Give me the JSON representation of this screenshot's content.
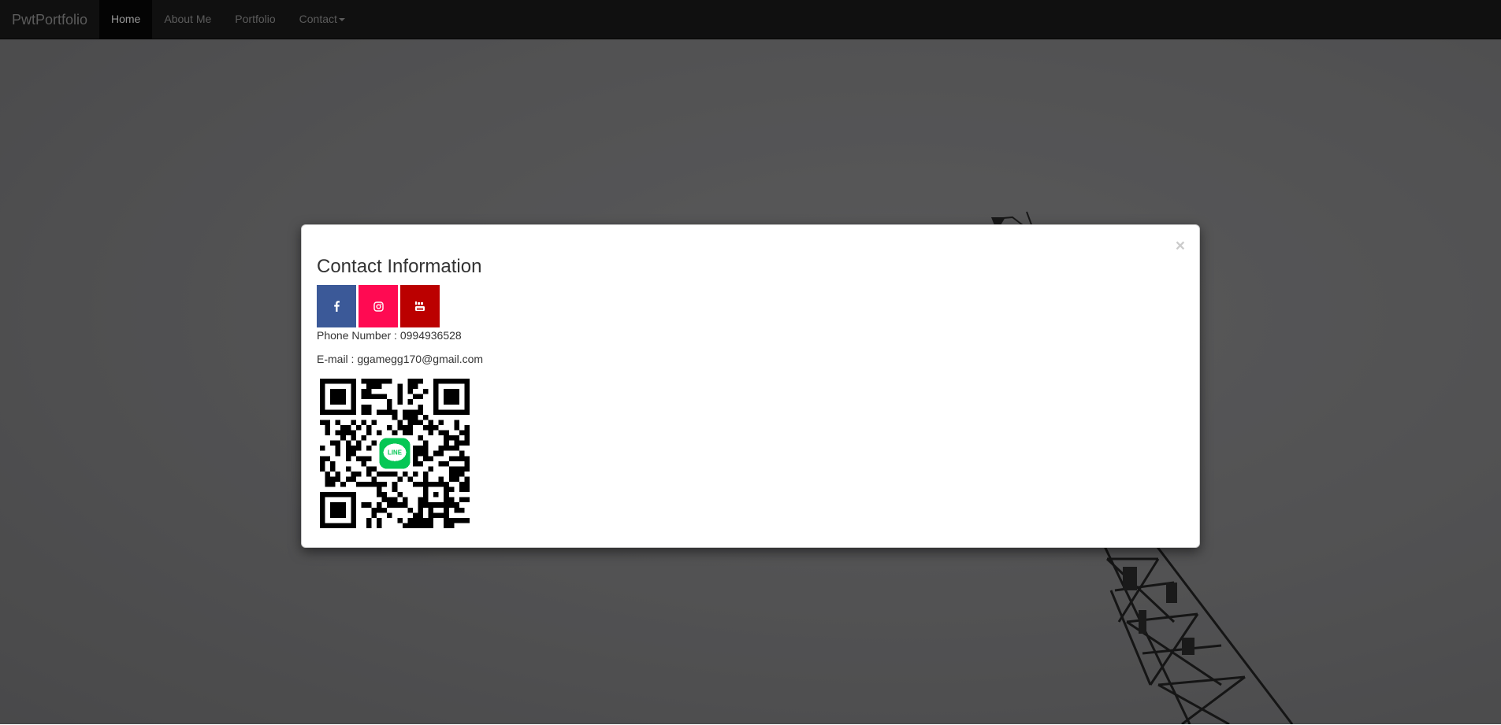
{
  "navbar": {
    "brand": "PwtPortfolio",
    "items": [
      {
        "label": "Home",
        "active": true
      },
      {
        "label": "About Me",
        "active": false
      },
      {
        "label": "Portfolio",
        "active": false
      },
      {
        "label": "Contact",
        "active": false,
        "dropdown": true
      }
    ]
  },
  "modal": {
    "title": "Contact Information",
    "close_label": "×",
    "social": [
      {
        "icon": "facebook-icon",
        "color": "#3b5998"
      },
      {
        "icon": "instagram-icon",
        "color": "#ff0a52"
      },
      {
        "icon": "youtube-icon",
        "color": "#bb0000"
      }
    ],
    "phone": "Phone Number : 0994936528",
    "email": "E-mail : ggamegg170@gmail.com",
    "qr_badge": "LINE"
  },
  "colors": {
    "navbar_bg": "#1c1c1c",
    "active_bg": "#080808",
    "line_green": "#06c755"
  }
}
